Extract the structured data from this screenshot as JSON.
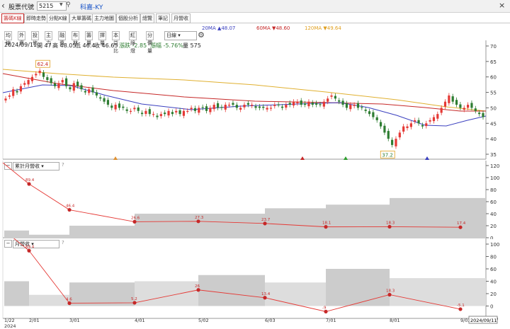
{
  "topbar": {
    "back_icon": "chevron-left-icon",
    "label": "股票代號",
    "code": "5215",
    "name": "科嘉-KY",
    "close": "×"
  },
  "tabs": [
    "籌碼K線",
    "即時走勢",
    "分點K線",
    "大單籌碼",
    "主力地圖",
    "個股分析",
    "總覽",
    "筆記",
    "月營收"
  ],
  "active_tab": 0,
  "toolbar": {
    "buttons": [
      "均線",
      "外資",
      "投信",
      "主力",
      "融資",
      "布林",
      "籌量",
      "擇量",
      "本益比",
      "紅綠燈",
      "分價量"
    ],
    "period": "日線",
    "settings_icon": "gear-icon"
  },
  "ma": {
    "ma20": "20MA ▲48.07",
    "ma60": "60MA ▼48.60",
    "ma120": "120MA ▼49.64"
  },
  "ohlc": {
    "date": "2024/09/11",
    "open": "開 47",
    "high": "高 48.05",
    "low": "低 46.4",
    "close": "收 46.65",
    "change": "漲跌 -2.85",
    "pct": "漲幅 -5.76%",
    "vol": "量 575"
  },
  "price_axis": [
    "70",
    "65",
    "60",
    "55",
    "50",
    "45",
    "40",
    "35"
  ],
  "price_marks": {
    "high": "62.4",
    "low": "37.2"
  },
  "panel2": {
    "title": "累計月營收",
    "help": "?",
    "axis": [
      "120",
      "100",
      "80",
      "60",
      "40",
      "20",
      "0"
    ]
  },
  "panel3": {
    "title": "月營收",
    "help": "?",
    "axis": [
      "100",
      "80",
      "60",
      "40",
      "20",
      "0",
      "-20"
    ]
  },
  "date_axis": [
    "1/22\n2024",
    "2/01",
    "3/01",
    "4/01",
    "5/02",
    "6/03",
    "7/01",
    "8/01",
    "9/02"
  ],
  "current_date": "2024/09/11",
  "colors": {
    "up": "#e53935",
    "down": "#2e7d32",
    "ma20": "#3a3fbf",
    "ma60": "#c62828",
    "ma120": "#e0b030"
  },
  "chart_data": [
    {
      "type": "line",
      "title": "累計月營收",
      "categories": [
        "1/22",
        "2/01",
        "3/01",
        "4/01",
        "5/02",
        "6/03",
        "7/01",
        "8/01",
        "9/02"
      ],
      "series": [
        {
          "name": "累計月營收",
          "values": [
            89.4,
            46.4,
            26.6,
            27.3,
            23.7,
            18.1,
            18.3,
            17.4
          ]
        }
      ],
      "ylim": [
        0,
        120
      ]
    },
    {
      "type": "line",
      "title": "月營收",
      "categories": [
        "1/22",
        "2/01",
        "3/01",
        "4/01",
        "5/02",
        "6/03",
        "7/01",
        "8/01",
        "9/02"
      ],
      "series": [
        {
          "name": "月營收",
          "values": [
            89.4,
            4.6,
            5.2,
            26,
            13.4,
            -9,
            18.3,
            -5.1
          ]
        }
      ],
      "ylim": [
        -20,
        100
      ]
    }
  ]
}
